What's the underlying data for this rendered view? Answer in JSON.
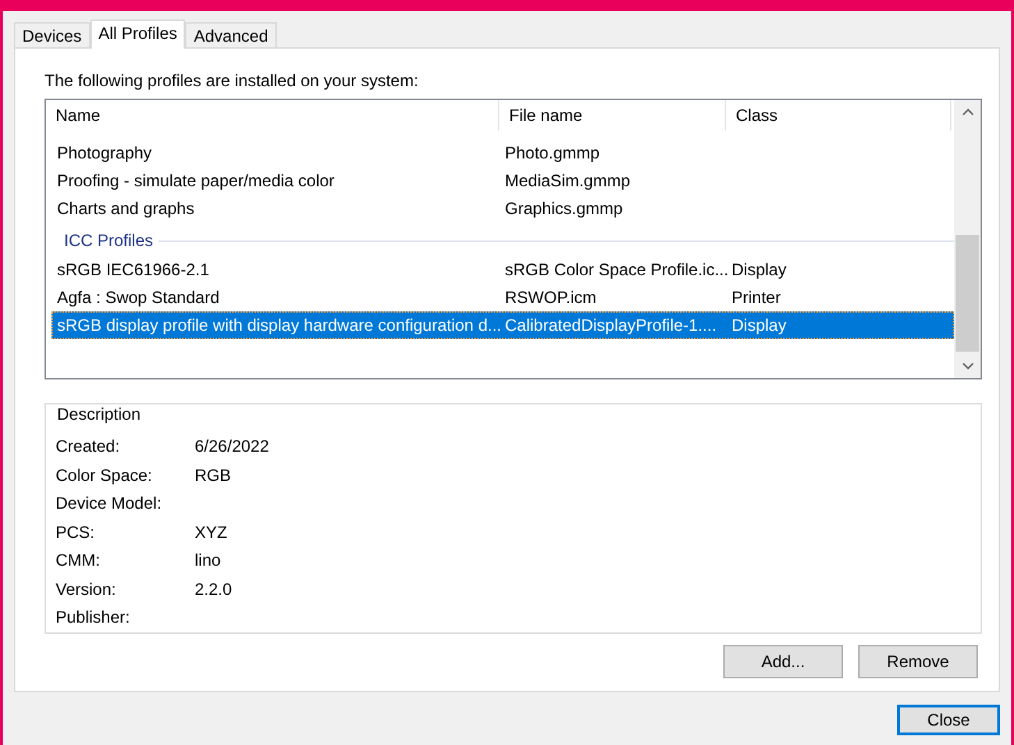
{
  "tabs": [
    {
      "label": "Devices",
      "selected": false
    },
    {
      "label": "All Profiles",
      "selected": true
    },
    {
      "label": "Advanced",
      "selected": false
    }
  ],
  "intro": "The following profiles are installed on your system:",
  "table": {
    "columns": [
      "Name",
      "File name",
      "Class"
    ],
    "groups": [
      {
        "rows": [
          {
            "name": "Photography",
            "file": "Photo.gmmp",
            "selected": false
          },
          {
            "name": "Proofing - simulate paper/media color",
            "file": "MediaSim.gmmp",
            "selected": false
          },
          {
            "name": "Charts and graphs",
            "file": "Graphics.gmmp",
            "selected": false
          }
        ]
      },
      {
        "heading": "ICC Profiles",
        "rows": [
          {
            "name": "sRGB IEC61966-2.1",
            "file": "sRGB Color Space Profile.ic...",
            "class": "Display",
            "selected": false
          },
          {
            "name": "Agfa : Swop Standard",
            "file": "RSWOP.icm",
            "class": "Printer",
            "selected": false
          },
          {
            "name": "sRGB display profile with display hardware configuration d...",
            "file": "CalibratedDisplayProfile-1....",
            "class": "Display",
            "selected": true
          }
        ]
      }
    ]
  },
  "description": {
    "title": "Description",
    "fields": [
      {
        "label": "Created:",
        "value": "6/26/2022"
      },
      {
        "label": "Color Space:",
        "value": "RGB"
      },
      {
        "label": "Device Model:"
      },
      {
        "label": "PCS:",
        "value": "XYZ"
      },
      {
        "label": "CMM:",
        "value": "lino"
      },
      {
        "label": "Version:",
        "value": "2.2.0"
      },
      {
        "label": "Publisher:"
      }
    ]
  },
  "buttons": [
    {
      "label": "Add...",
      "default": false
    },
    {
      "label": "Remove",
      "default": false
    }
  ],
  "footer_buttons": [
    {
      "label": "Close",
      "default": true
    }
  ]
}
